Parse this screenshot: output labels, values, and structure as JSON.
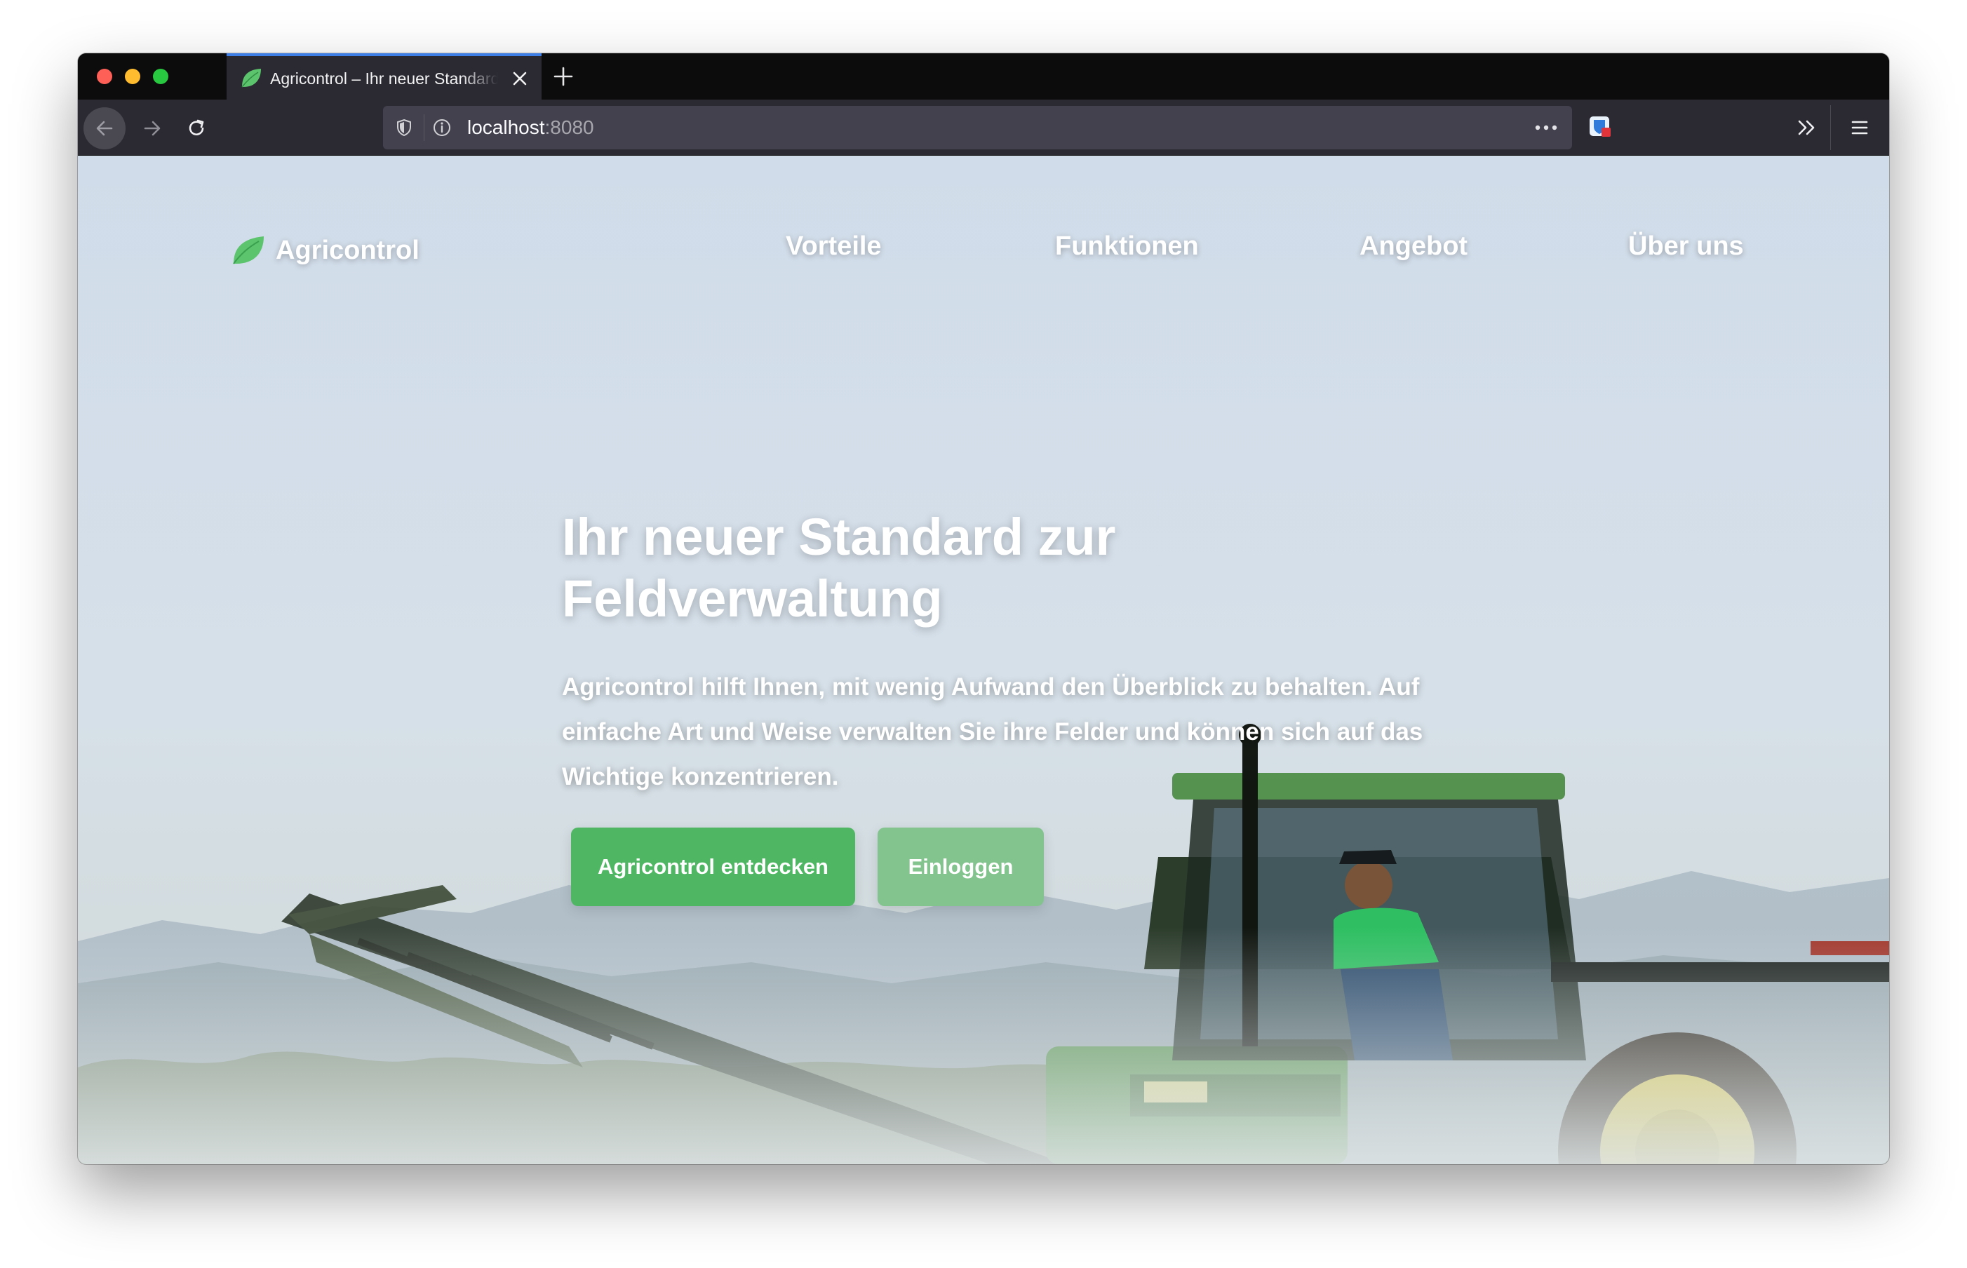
{
  "browser": {
    "tab_title": "Agricontrol – Ihr neuer Standard zur Feldverwaltung",
    "url_host": "localhost",
    "url_port": ":8080",
    "accent_color": "#3d7fe6",
    "icons": [
      "back-arrow-icon",
      "forward-arrow-icon",
      "reload-icon",
      "shield-icon",
      "info-icon",
      "more-horizontal-icon",
      "extension-icon",
      "chevron-double-right-icon",
      "hamburger-menu-icon",
      "close-icon",
      "plus-icon"
    ]
  },
  "site": {
    "brand": "Agricontrol",
    "brand_color": "#4fb763",
    "nav": [
      "Vorteile",
      "Funktionen",
      "Angebot",
      "Über uns"
    ]
  },
  "hero": {
    "title": "Ihr neuer Standard zur Feldverwaltung",
    "text": "Agricontrol hilft Ihnen, mit wenig Aufwand den Überblick zu behalten. Auf einfache Art und Weise verwalten Sie ihre Felder und können sich auf das Wichtige konzentrieren.",
    "primary_button": "Agricontrol entdecken",
    "secondary_button": "Einloggen",
    "primary_color": "#4fb763",
    "secondary_color": "#83c48e"
  }
}
